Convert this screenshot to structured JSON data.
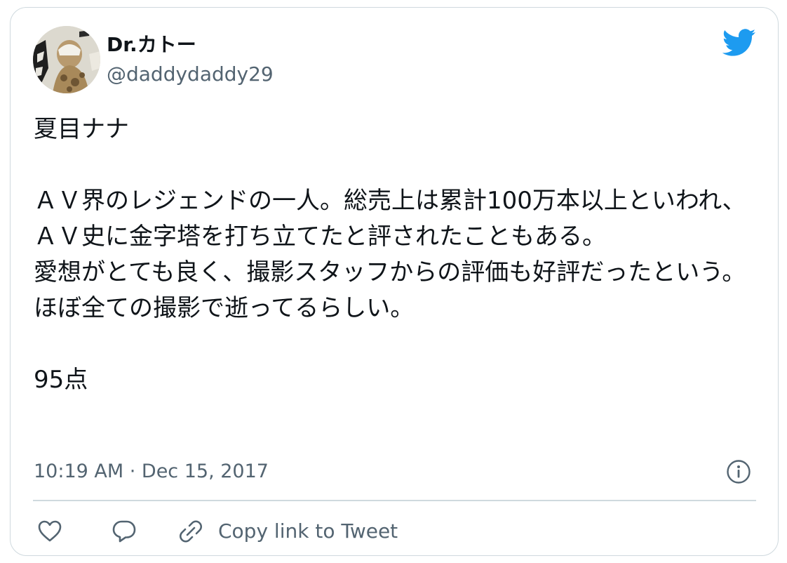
{
  "author": {
    "display_name": "Dr.カトー",
    "handle": "@daddydaddy29"
  },
  "tweet": {
    "text": "夏目ナナ\n\nＡＶ界のレジェンドの一人。総売上は累計100万本以上といわれ、ＡＶ史に金字塔を打ち立てたと評されたこともある。\n愛想がとても良く、撮影スタッフからの評価も好評だったという。\nほぼ全ての撮影で逝ってるらしい。\n\n95点",
    "timestamp": "10:19 AM · Dec 15, 2017"
  },
  "actions": {
    "copy_link_label": "Copy link to Tweet"
  },
  "icons": {
    "logo": "twitter-bird-icon",
    "info": "info-icon",
    "like": "heart-icon",
    "reply": "reply-bubble-icon",
    "link": "link-icon"
  },
  "colors": {
    "brand": "#1d9bf0",
    "text_primary": "#0f1419",
    "text_secondary": "#536471",
    "border": "#cfd9de"
  }
}
